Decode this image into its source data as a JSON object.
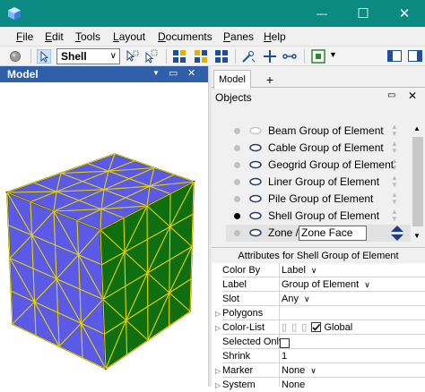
{
  "window": {
    "minimize": "—",
    "maximize": "☐",
    "close": "✕"
  },
  "menu": {
    "items": [
      {
        "label": "File",
        "key": "F",
        "rest": "ile"
      },
      {
        "label": "Edit",
        "key": "E",
        "rest": "dit"
      },
      {
        "label": "Tools",
        "key": "T",
        "rest": "ools"
      },
      {
        "label": "Layout",
        "key": "L",
        "rest": "ayout"
      },
      {
        "label": "Documents",
        "key": "D",
        "rest": "ocuments"
      },
      {
        "label": "Panes",
        "key": "P",
        "rest": "anes"
      },
      {
        "label": "Help",
        "key": "H",
        "rest": "elp"
      }
    ]
  },
  "toolbar": {
    "mode_select": "Shell"
  },
  "model_pane": {
    "title": "Model",
    "pin": "▼",
    "restore": "▭",
    "close": "✕"
  },
  "tabs": {
    "model": "Model",
    "add": "+"
  },
  "objects": {
    "title": "Objects",
    "rows": [
      {
        "label": "Beam Group of Element",
        "dot": "#c0c0c0",
        "eye": "#c8c8c8"
      },
      {
        "label": "Cable Group of Element",
        "dot": "#c0c0c0",
        "eye": "#2a3b6e"
      },
      {
        "label": "Geogrid Group of Element",
        "dot": "#c0c0c0",
        "eye": "#2a3b6e"
      },
      {
        "label": "Liner Group of Element",
        "dot": "#c0c0c0",
        "eye": "#2a3b6e"
      },
      {
        "label": "Pile Group of Element",
        "dot": "#c0c0c0",
        "eye": "#2a3b6e"
      },
      {
        "label": "Shell Group of Element",
        "dot": "#000000",
        "eye": "#2a3b6e"
      },
      {
        "label": "Zone / ",
        "dot": "#c0c0c0",
        "eye": "#2a3b6e"
      }
    ],
    "zone_face": "Zone Face"
  },
  "attributes": {
    "title": "Attributes for Shell Group of Element",
    "rows": [
      {
        "label": "Color By",
        "value": "Label"
      },
      {
        "label": "Label",
        "value": "Group of Element"
      },
      {
        "label": "Slot",
        "value": "Any"
      },
      {
        "label": "Polygons",
        "value": ""
      },
      {
        "label": "Color-List",
        "value": "Global"
      },
      {
        "label": "Selected Only",
        "value": ""
      },
      {
        "label": "Shrink",
        "value": "1"
      },
      {
        "label": "Marker",
        "value": "None"
      },
      {
        "label": "System",
        "value": "None"
      }
    ]
  },
  "colors": {
    "titlebar": "#0a8a80",
    "pane_header": "#2f5fa8",
    "cube_face_blue": "#5a5ae6",
    "cube_face_green": "#0f6e0f",
    "mesh_line": "#e6d400"
  }
}
